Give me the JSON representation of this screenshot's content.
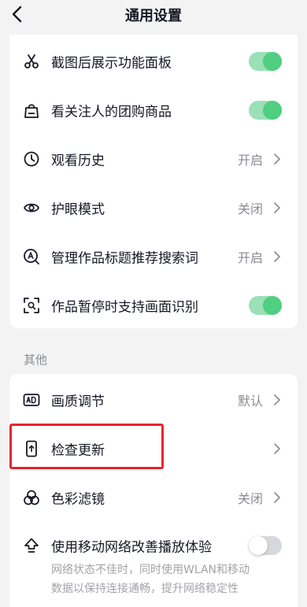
{
  "header": {
    "title": "通用设置"
  },
  "settings_top": [
    {
      "label": "截图后展示功能面板",
      "control": "toggle",
      "state": "on",
      "icon": "scissors-icon"
    },
    {
      "label": "看关注人的团购商品",
      "control": "toggle",
      "state": "on",
      "icon": "shopping-bag-icon"
    },
    {
      "label": "观看历史",
      "control": "value",
      "value": "开启",
      "icon": "clock-icon"
    },
    {
      "label": "护眼模式",
      "control": "value",
      "value": "关闭",
      "icon": "eye-icon"
    },
    {
      "label": "管理作品标题推荐搜索词",
      "control": "value",
      "value": "开启",
      "icon": "search-a-icon"
    },
    {
      "label": "作品暂停时支持画面识别",
      "control": "toggle",
      "state": "on",
      "icon": "scan-icon"
    }
  ],
  "section_other": {
    "label": "其他"
  },
  "settings_other": [
    {
      "label": "画质调节",
      "control": "value",
      "value": "默认",
      "icon": "ad-icon"
    },
    {
      "label": "检查更新",
      "control": "chevron",
      "icon": "phone-update-icon"
    },
    {
      "label": "色彩滤镜",
      "control": "value",
      "value": "关闭",
      "icon": "color-filter-icon"
    },
    {
      "label": "使用移动网络改善播放体验",
      "control": "toggle",
      "state": "off",
      "icon": "upload-arrow-icon"
    }
  ],
  "network_desc": {
    "line1": "网络状态不佳时，同时使用WLAN和移动",
    "line2": "数据以保持连接通畅，提升网络稳定性"
  },
  "colors": {
    "toggle_on": "#4fcf7f",
    "highlight": "#e8242c"
  }
}
